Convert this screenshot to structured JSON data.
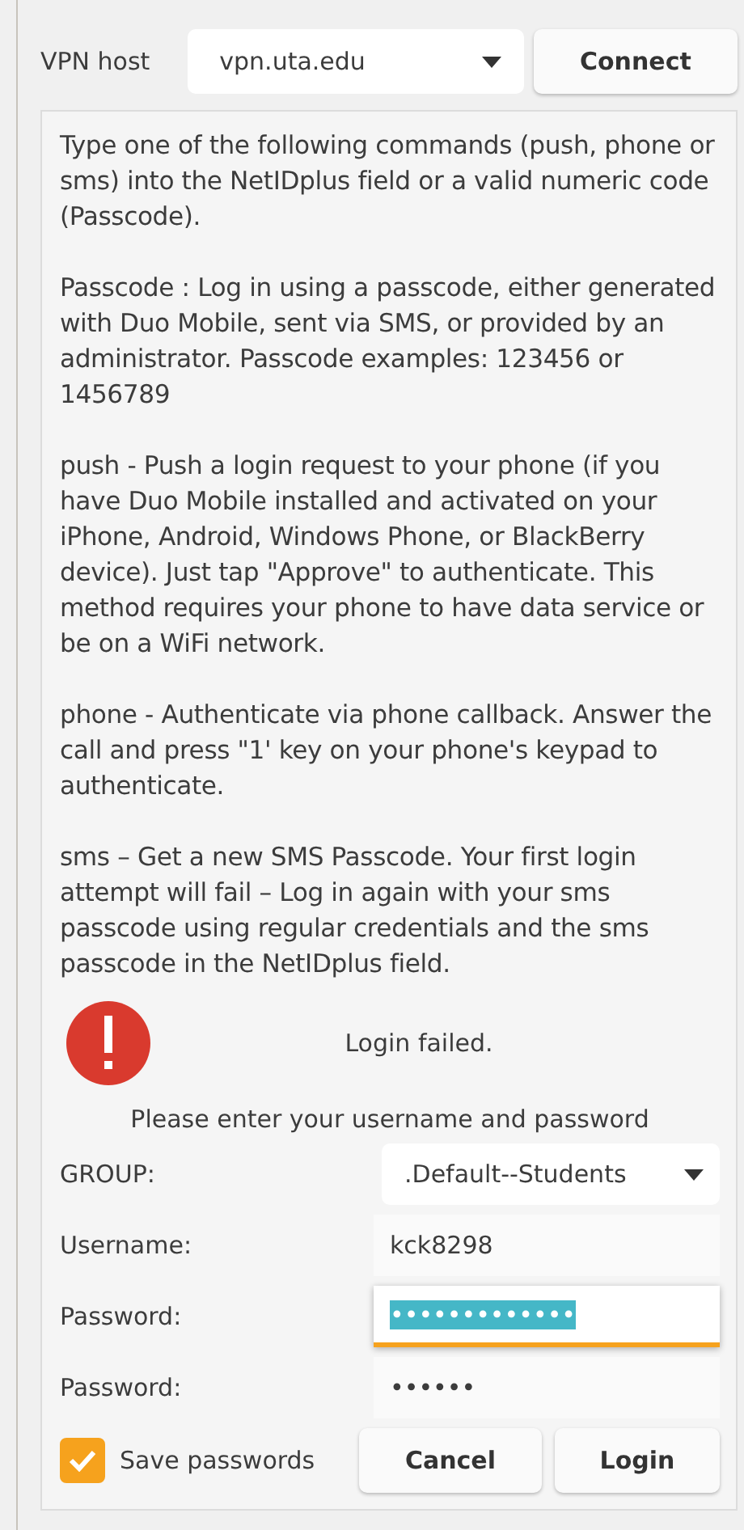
{
  "vpn_host": {
    "label": "VPN host",
    "value": "vpn.uta.edu",
    "connect_button": "Connect"
  },
  "instructions": [
    "Type one of the following commands (push, phone or sms) into the NetIDplus field or a valid numeric code (Passcode).",
    "Passcode : Log in using a passcode, either generated with Duo Mobile, sent via SMS, or provided by an administrator. Passcode examples: 123456 or 1456789",
    "push  - Push a login request to your phone (if you have Duo Mobile installed and activated on your iPhone, Android, Windows Phone, or BlackBerry device). Just tap \"Approve\" to authenticate. This method requires your phone to have data service or be on a WiFi network.",
    "phone -  Authenticate via phone callback. Answer the call and press \"1' key on your phone's keypad to authenticate.",
    "sms – Get a new SMS Passcode. Your first login attempt will fail – Log in again with your sms passcode using regular credentials and the sms passcode in the NetIDplus field."
  ],
  "error": {
    "message": "Login failed."
  },
  "prompt": "Please enter your username and password",
  "fields": [
    {
      "kind": "dropdown",
      "label": "GROUP:",
      "value": ".Default--Students",
      "focused": false,
      "text_selected": false
    },
    {
      "kind": "text",
      "label": "Username:",
      "value": "kck8298",
      "focused": false,
      "text_selected": false
    },
    {
      "kind": "text",
      "label": "Password:",
      "value": "•••••••••••••",
      "focused": true,
      "text_selected": true
    },
    {
      "kind": "text",
      "label": "Password:",
      "value": "••••••",
      "focused": false,
      "text_selected": false
    }
  ],
  "save_passwords": {
    "label": "Save passwords",
    "checked": true
  },
  "buttons": [
    "Cancel",
    "Login"
  ]
}
